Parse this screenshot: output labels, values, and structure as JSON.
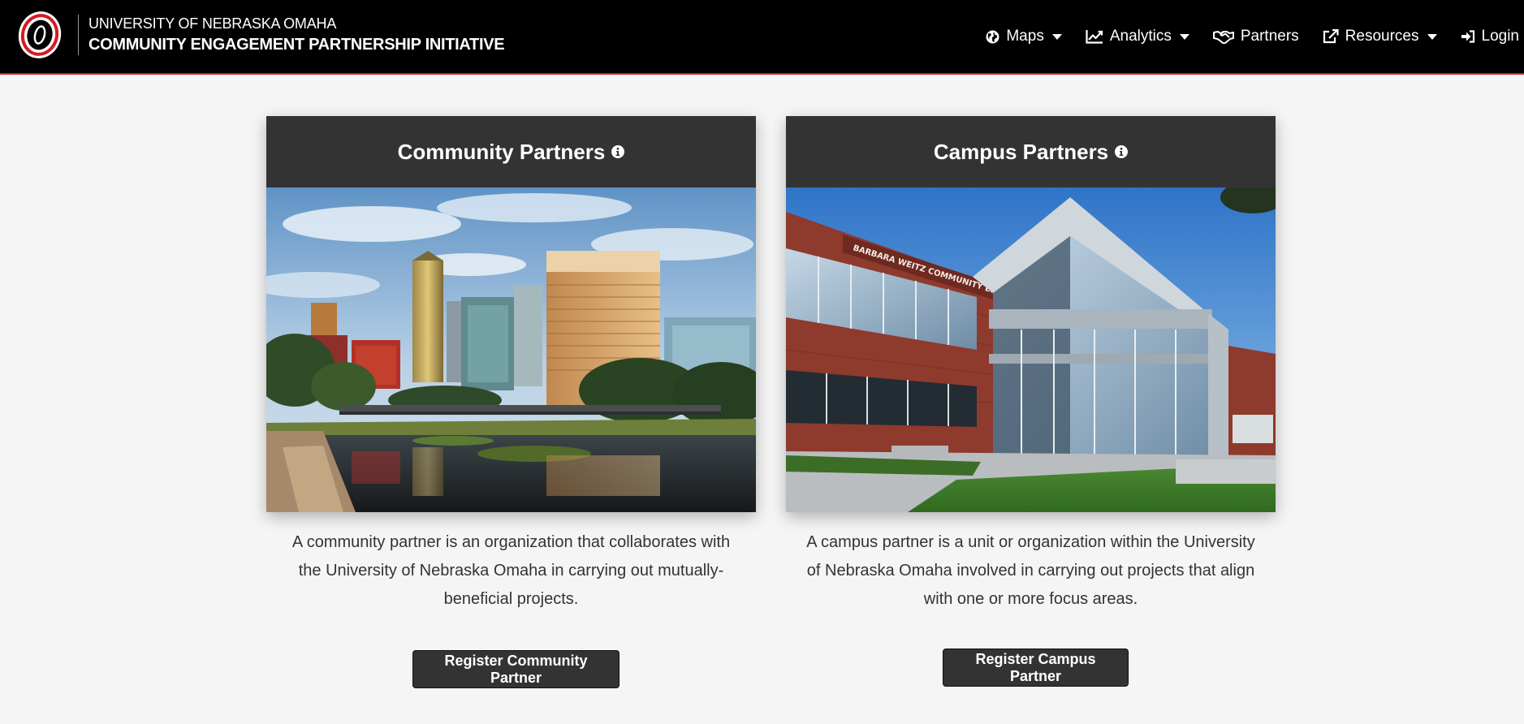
{
  "header": {
    "university_name": "UNIVERSITY OF NEBRASKA OMAHA",
    "initiative_name": "COMMUNITY ENGAGEMENT PARTNERSHIP INITIATIVE",
    "brand_color": "#d71920"
  },
  "nav": {
    "items": [
      {
        "label": "Maps",
        "icon": "globe-icon",
        "dropdown": true
      },
      {
        "label": "Analytics",
        "icon": "line-chart-icon",
        "dropdown": true
      },
      {
        "label": "Partners",
        "icon": "handshake-icon",
        "dropdown": false
      },
      {
        "label": "Resources",
        "icon": "external-link-icon",
        "dropdown": true
      },
      {
        "label": "Login",
        "icon": "sign-in-icon",
        "dropdown": false
      }
    ]
  },
  "cards": [
    {
      "title": "Community Partners",
      "image": "omaha-city-skyline-photo",
      "description": "A community partner is an organization that collaborates with the University of Nebraska Omaha in carrying out mutually-beneficial projects.",
      "button_label": "Register Community Partner"
    },
    {
      "title": "Campus Partners",
      "image": "community-engagement-center-building-photo",
      "sign_text": "BARBARA WEITZ COMMUNITY ENGAGEMENT CENTER",
      "description": "A campus partner is a unit or organization within the University of Nebraska Omaha involved in carrying out projects that align with one or more focus areas.",
      "button_label": "Register Campus Partner"
    }
  ]
}
